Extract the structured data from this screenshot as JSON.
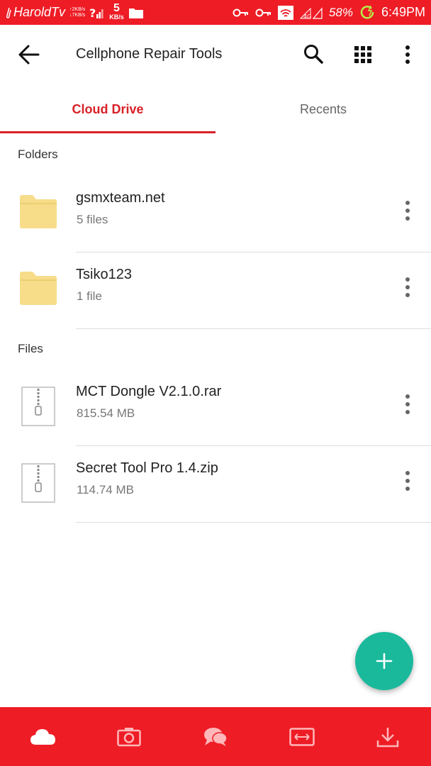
{
  "status_bar": {
    "carrier": "HaroldTv",
    "net_up": "↑2KB/s",
    "net_down": "↓7KB/s",
    "speed_value": "5",
    "speed_unit": "KB/s",
    "battery": "58%",
    "time": "6:49PM"
  },
  "header": {
    "title": "Cellphone Repair Tools"
  },
  "tabs": [
    {
      "label": "Cloud Drive",
      "active": true
    },
    {
      "label": "Recents",
      "active": false
    }
  ],
  "sections": {
    "folders_label": "Folders",
    "files_label": "Files"
  },
  "folders": [
    {
      "name": "gsmxteam.net",
      "meta": "5 files"
    },
    {
      "name": "Tsiko123",
      "meta": "1 file"
    }
  ],
  "files": [
    {
      "name": "MCT Dongle V2.1.0.rar",
      "meta": "815.54 MB"
    },
    {
      "name": "Secret Tool Pro 1.4.zip",
      "meta": "114.74 MB"
    }
  ],
  "bottom_nav": [
    "cloud-icon",
    "camera-icon",
    "chat-icon",
    "transfer-icon",
    "download-icon"
  ],
  "colors": {
    "brand_red": "#ee1c25",
    "active_tab": "#d82128",
    "fab": "#1ab99c",
    "folder": "#f7dc8a"
  }
}
